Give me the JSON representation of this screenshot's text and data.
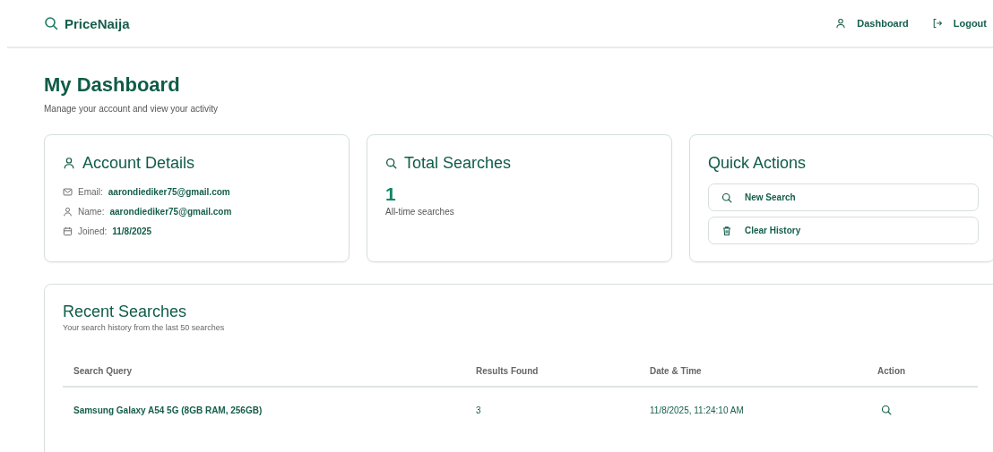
{
  "header": {
    "brand": "PriceNaija",
    "nav": [
      {
        "label": "Dashboard"
      },
      {
        "label": "Logout"
      }
    ]
  },
  "page": {
    "title": "My Dashboard",
    "subtitle": "Manage your account and view your activity"
  },
  "account": {
    "title": "Account Details",
    "fields": [
      {
        "label": "Email:",
        "value": "aarondiediker75@gmail.com"
      },
      {
        "label": "Name:",
        "value": "aarondiediker75@gmail.com"
      },
      {
        "label": "Joined:",
        "value": "11/8/2025"
      }
    ]
  },
  "total": {
    "title": "Total Searches",
    "count": "1",
    "caption": "All-time searches"
  },
  "quick_actions": {
    "title": "Quick Actions",
    "buttons": [
      {
        "label": "New Search"
      },
      {
        "label": "Clear History"
      }
    ]
  },
  "recent": {
    "title": "Recent Searches",
    "subtitle": "Your search history from the last 50 searches",
    "columns": [
      "Search Query",
      "Results Found",
      "Date & Time",
      "Action"
    ],
    "rows": [
      {
        "query": "Samsung Galaxy A54 5G (8GB RAM, 256GB)",
        "results": "3",
        "date": "11/8/2025, 11:24:10 AM"
      }
    ]
  }
}
